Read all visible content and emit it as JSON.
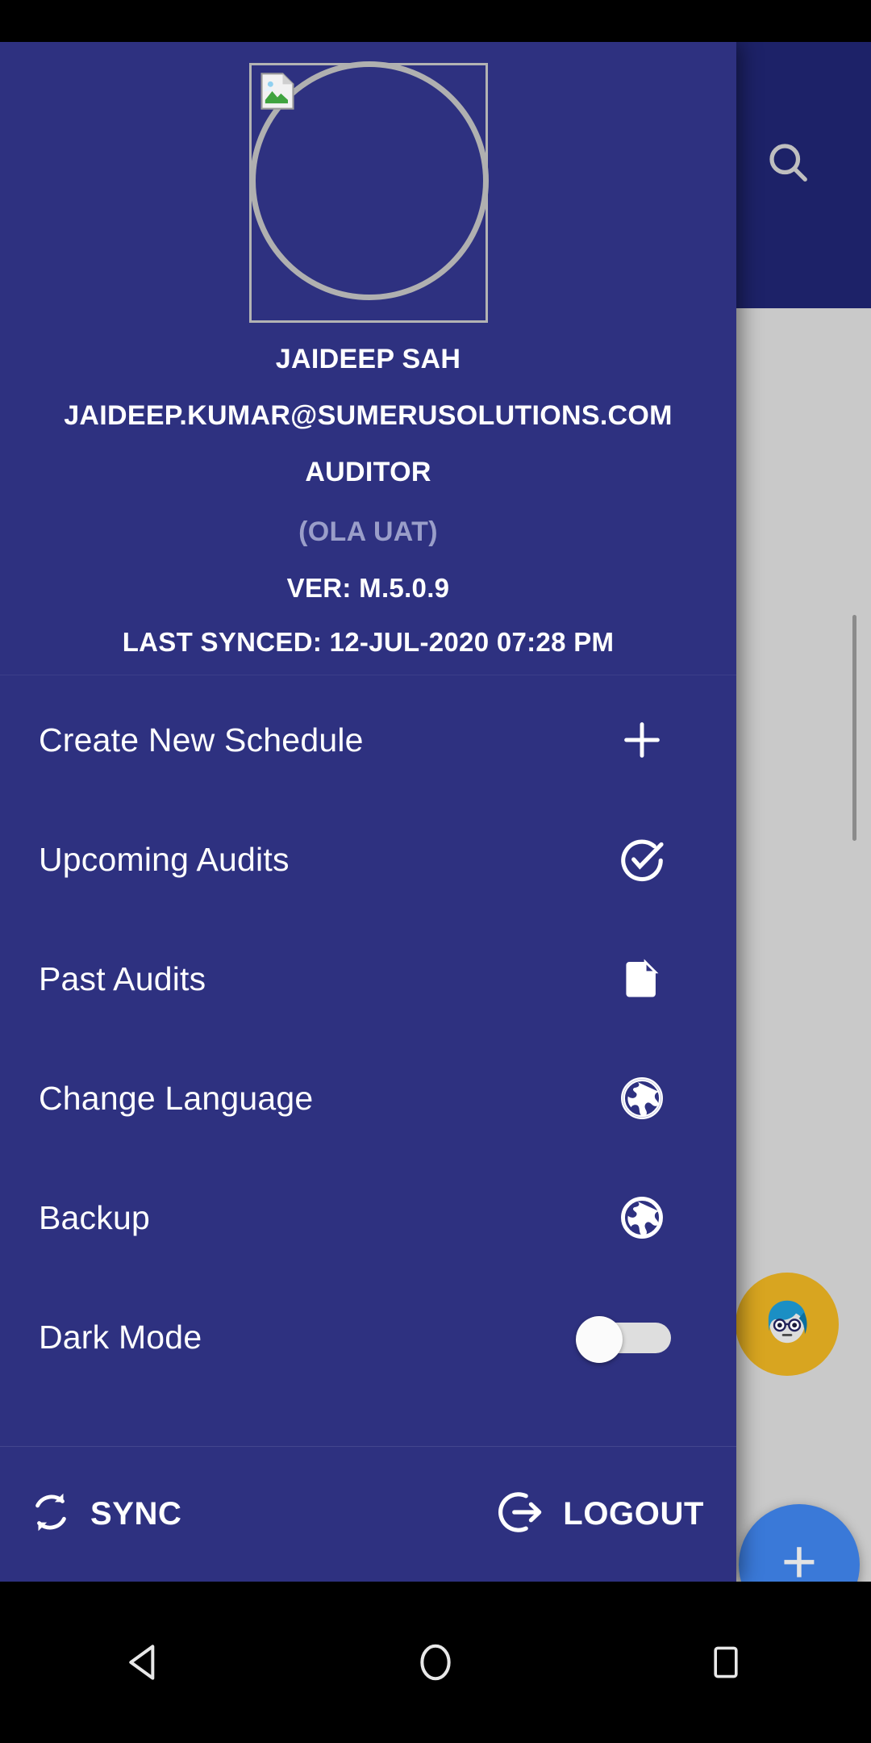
{
  "status_bar": {
    "name": "android-status-bar"
  },
  "background_app": {
    "search_icon": "search-icon",
    "avatar_chip": "user-avatar",
    "fab_label": "+"
  },
  "drawer": {
    "profile": {
      "avatar_placeholder": "broken-image-icon",
      "name": "JAIDEEP SAH",
      "email": "JAIDEEP.KUMAR@SUMERUSOLUTIONS.COM",
      "role": "AUDITOR",
      "environment": "(OLA UAT)",
      "version": "VER: M.5.0.9",
      "last_synced": "LAST SYNCED: 12-JUL-2020 07:28 PM"
    },
    "menu_items": [
      {
        "label": "Create New Schedule",
        "icon": "plus-icon",
        "type": "link"
      },
      {
        "label": "Upcoming Audits",
        "icon": "check-circle-icon",
        "type": "link"
      },
      {
        "label": "Past Audits",
        "icon": "document-icon",
        "type": "link"
      },
      {
        "label": "Change Language",
        "icon": "globe-icon",
        "type": "link"
      },
      {
        "label": "Backup",
        "icon": "globe-icon",
        "type": "link"
      },
      {
        "label": "Dark Mode",
        "icon": "toggle-switch",
        "type": "toggle",
        "state": "off"
      }
    ],
    "footer": {
      "sync_label": "SYNC",
      "sync_icon": "sync-icon",
      "logout_label": "LOGOUT",
      "logout_icon": "logout-icon"
    }
  },
  "nav_bar": {
    "back": "back-triangle-icon",
    "home": "home-circle-icon",
    "recents": "recents-square-icon"
  },
  "colors": {
    "drawer_bg": "#2e3180",
    "appbar_bg": "#1d2268",
    "app_body_bg": "#c9c9c9",
    "fab_blue": "#3a79d8",
    "avatar_gold": "#d8a520",
    "muted_text": "#9a9ec9"
  }
}
